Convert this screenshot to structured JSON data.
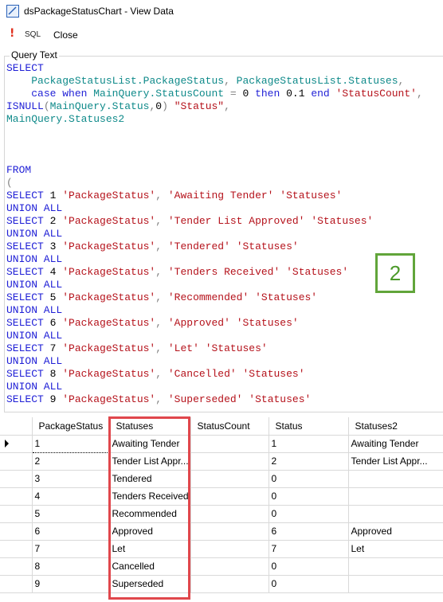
{
  "window": {
    "title": "dsPackageStatusChart - View Data"
  },
  "toolbar": {
    "sql_label": "SQL",
    "close_label": "Close"
  },
  "query": {
    "group_label": "Query Text",
    "lines": [
      [
        [
          "kw",
          "SELECT"
        ]
      ],
      [
        [
          "nm",
          "    "
        ],
        [
          "id",
          "PackageStatusList.PackageStatus"
        ],
        [
          "pu",
          ", "
        ],
        [
          "id",
          "PackageStatusList.Statuses"
        ],
        [
          "pu",
          ","
        ]
      ],
      [
        [
          "nm",
          "    "
        ],
        [
          "kw",
          "case when "
        ],
        [
          "id",
          "MainQuery.StatusCount"
        ],
        [
          "pu",
          " = "
        ],
        [
          "nm",
          "0 "
        ],
        [
          "kw",
          "then "
        ],
        [
          "nm",
          "0.1 "
        ],
        [
          "kw",
          "end "
        ],
        [
          "st",
          "'StatusCount'"
        ],
        [
          "pu",
          ","
        ]
      ],
      [
        [
          "kw",
          "ISNULL"
        ],
        [
          "pu",
          "("
        ],
        [
          "id",
          "MainQuery.Status"
        ],
        [
          "pu",
          ","
        ],
        [
          "nm",
          "0"
        ],
        [
          "pu",
          ") "
        ],
        [
          "st",
          "\"Status\""
        ],
        [
          "pu",
          ","
        ]
      ],
      [
        [
          "id",
          "MainQuery.Statuses2"
        ]
      ],
      [],
      [],
      [],
      [
        [
          "kw",
          "FROM"
        ]
      ],
      [
        [
          "pu",
          "("
        ]
      ],
      [
        [
          "kw",
          "SELECT "
        ],
        [
          "nm",
          "1 "
        ],
        [
          "st",
          "'PackageStatus'"
        ],
        [
          "pu",
          ", "
        ],
        [
          "st",
          "'Awaiting Tender'"
        ],
        [
          "nm",
          " "
        ],
        [
          "st",
          "'Statuses'"
        ]
      ],
      [
        [
          "kw",
          "UNION ALL"
        ]
      ],
      [
        [
          "kw",
          "SELECT "
        ],
        [
          "nm",
          "2 "
        ],
        [
          "st",
          "'PackageStatus'"
        ],
        [
          "pu",
          ", "
        ],
        [
          "st",
          "'Tender List Approved'"
        ],
        [
          "nm",
          " "
        ],
        [
          "st",
          "'Statuses'"
        ]
      ],
      [
        [
          "kw",
          "UNION ALL"
        ]
      ],
      [
        [
          "kw",
          "SELECT "
        ],
        [
          "nm",
          "3 "
        ],
        [
          "st",
          "'PackageStatus'"
        ],
        [
          "pu",
          ", "
        ],
        [
          "st",
          "'Tendered'"
        ],
        [
          "nm",
          " "
        ],
        [
          "st",
          "'Statuses'"
        ]
      ],
      [
        [
          "kw",
          "UNION ALL"
        ]
      ],
      [
        [
          "kw",
          "SELECT "
        ],
        [
          "nm",
          "4 "
        ],
        [
          "st",
          "'PackageStatus'"
        ],
        [
          "pu",
          ", "
        ],
        [
          "st",
          "'Tenders Received'"
        ],
        [
          "nm",
          " "
        ],
        [
          "st",
          "'Statuses'"
        ]
      ],
      [
        [
          "kw",
          "UNION ALL"
        ]
      ],
      [
        [
          "kw",
          "SELECT "
        ],
        [
          "nm",
          "5 "
        ],
        [
          "st",
          "'PackageStatus'"
        ],
        [
          "pu",
          ", "
        ],
        [
          "st",
          "'Recommended'"
        ],
        [
          "nm",
          " "
        ],
        [
          "st",
          "'Statuses'"
        ]
      ],
      [
        [
          "kw",
          "UNION ALL"
        ]
      ],
      [
        [
          "kw",
          "SELECT "
        ],
        [
          "nm",
          "6 "
        ],
        [
          "st",
          "'PackageStatus'"
        ],
        [
          "pu",
          ", "
        ],
        [
          "st",
          "'Approved'"
        ],
        [
          "nm",
          " "
        ],
        [
          "st",
          "'Statuses'"
        ]
      ],
      [
        [
          "kw",
          "UNION ALL"
        ]
      ],
      [
        [
          "kw",
          "SELECT "
        ],
        [
          "nm",
          "7 "
        ],
        [
          "st",
          "'PackageStatus'"
        ],
        [
          "pu",
          ", "
        ],
        [
          "st",
          "'Let'"
        ],
        [
          "nm",
          " "
        ],
        [
          "st",
          "'Statuses'"
        ]
      ],
      [
        [
          "kw",
          "UNION ALL"
        ]
      ],
      [
        [
          "kw",
          "SELECT "
        ],
        [
          "nm",
          "8 "
        ],
        [
          "st",
          "'PackageStatus'"
        ],
        [
          "pu",
          ", "
        ],
        [
          "st",
          "'Cancelled'"
        ],
        [
          "nm",
          " "
        ],
        [
          "st",
          "'Statuses'"
        ]
      ],
      [
        [
          "kw",
          "UNION ALL"
        ]
      ],
      [
        [
          "kw",
          "SELECT "
        ],
        [
          "nm",
          "9 "
        ],
        [
          "st",
          "'PackageStatus'"
        ],
        [
          "pu",
          ", "
        ],
        [
          "st",
          "'Superseded'"
        ],
        [
          "nm",
          " "
        ],
        [
          "st",
          "'Statuses'"
        ]
      ]
    ]
  },
  "badge": {
    "label": "2",
    "color": "#61a53a"
  },
  "grid": {
    "columns": [
      "PackageStatus",
      "Statuses",
      "StatusCount",
      "Status",
      "Statuses2"
    ],
    "rows": [
      [
        "1",
        "Awaiting Tender",
        "",
        "1",
        "Awaiting Tender"
      ],
      [
        "2",
        "Tender List Appr...",
        "",
        "2",
        "Tender List Appr..."
      ],
      [
        "3",
        "Tendered",
        "",
        "0",
        ""
      ],
      [
        "4",
        "Tenders Received",
        "",
        "0",
        ""
      ],
      [
        "5",
        "Recommended",
        "",
        "0",
        ""
      ],
      [
        "6",
        "Approved",
        "",
        "6",
        "Approved"
      ],
      [
        "7",
        "Let",
        "",
        "7",
        "Let"
      ],
      [
        "8",
        "Cancelled",
        "",
        "0",
        ""
      ],
      [
        "9",
        "Superseded",
        "",
        "0",
        ""
      ]
    ],
    "current_row_indicator": "right-triangle-icon",
    "highlight_color": "#e0474c"
  }
}
